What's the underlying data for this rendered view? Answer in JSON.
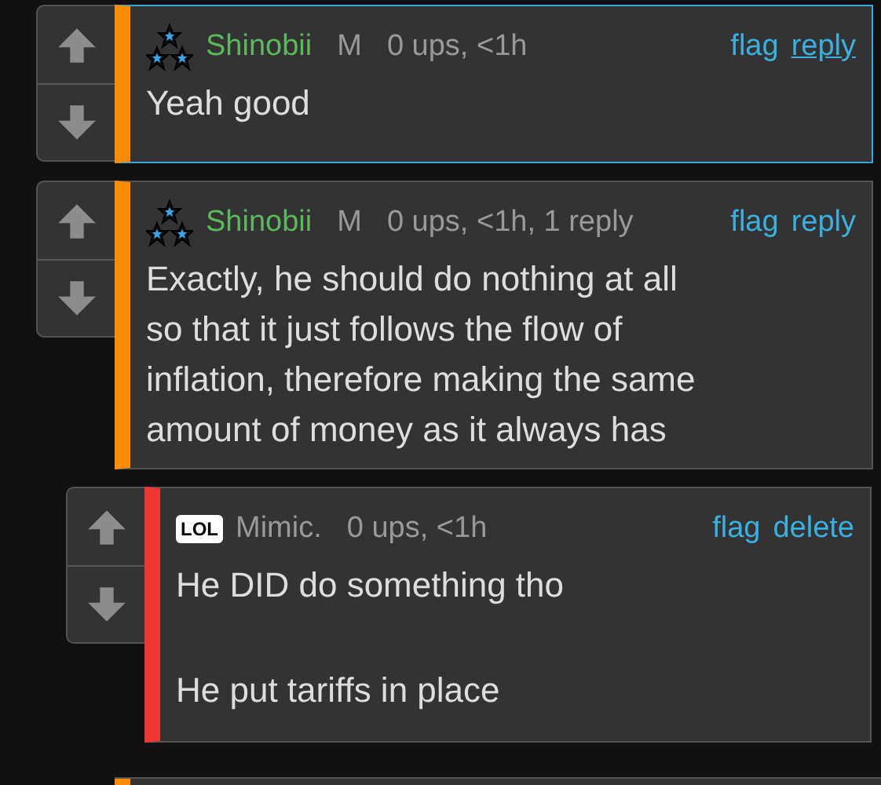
{
  "comments": [
    {
      "badge": {
        "kind": "stars"
      },
      "username": "Shinobii",
      "username_highlighted": true,
      "role": "M",
      "meta": "0 ups, <1h",
      "color": "#ff8c00",
      "highlighted": true,
      "actions": [
        {
          "label": "flag",
          "underlined": false
        },
        {
          "label": "reply",
          "underlined": true
        }
      ],
      "paragraphs": [
        [
          "Yeah good"
        ]
      ]
    },
    {
      "badge": {
        "kind": "stars"
      },
      "username": "Shinobii",
      "username_highlighted": true,
      "role": "M",
      "meta": "0 ups, <1h, 1 reply",
      "color": "#ff8c00",
      "highlighted": false,
      "actions": [
        {
          "label": "flag",
          "underlined": false
        },
        {
          "label": "reply",
          "underlined": false
        }
      ],
      "paragraphs": [
        [
          "Exactly, he should do nothing at all",
          "so that it just follows the flow of",
          "inflation, therefore making the same",
          "amount of money as it always has"
        ]
      ],
      "children": [
        {
          "badge": {
            "kind": "lol",
            "text": "LOL"
          },
          "username": "Mimic.",
          "username_highlighted": false,
          "meta": "0 ups, <1h",
          "color": "#f03535",
          "highlighted": false,
          "actions": [
            {
              "label": "flag",
              "underlined": false
            },
            {
              "label": "delete",
              "underlined": false
            }
          ],
          "paragraphs": [
            [
              "He DID do something tho"
            ],
            [
              "He put tariffs in place"
            ]
          ]
        }
      ]
    }
  ],
  "partial_comment": {
    "color": "#ff8c00"
  }
}
